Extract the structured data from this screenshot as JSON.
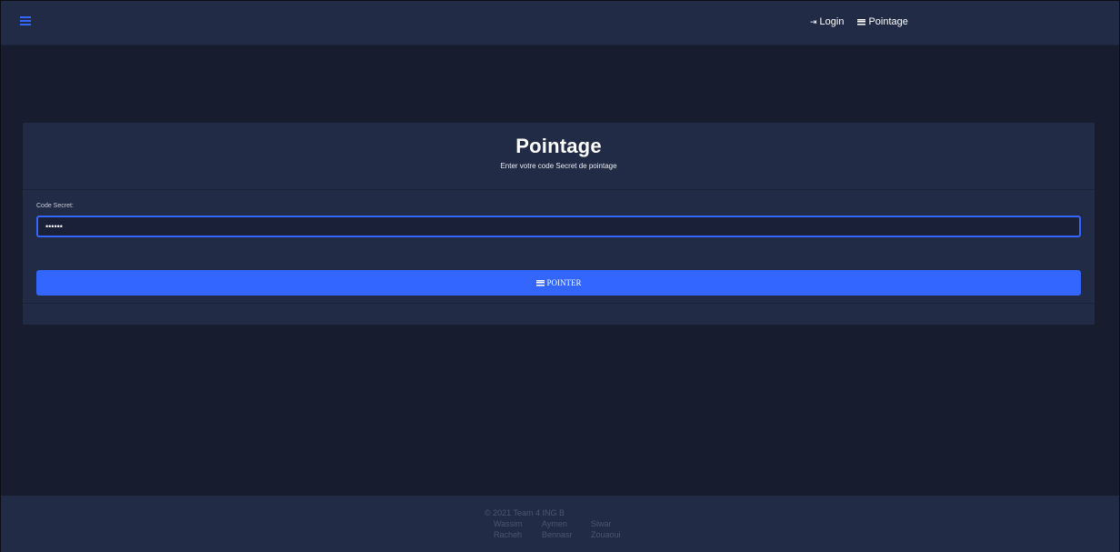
{
  "navbar": {
    "menu_icon": "hamburger-menu-icon",
    "links": [
      {
        "label": "Login",
        "icon": "sign-in-icon"
      },
      {
        "label": "Pointage",
        "icon": "list-icon"
      }
    ]
  },
  "card": {
    "title": "Pointage",
    "subtitle": "Enter votre code Secret de pointage",
    "field_label": "Code Secret:",
    "input_value": "••••••",
    "button_label": "POINTER",
    "button_icon": "list-icon"
  },
  "footer": {
    "copyright": "© 2021 Team 4 ING B",
    "names": [
      "Wassim",
      "Aymen",
      "Siwar",
      "Racheh",
      "Bennasr",
      "Zouaoui"
    ]
  },
  "colors": {
    "background": "#171c2f",
    "surface": "#222b45",
    "accent": "#3366ff"
  }
}
